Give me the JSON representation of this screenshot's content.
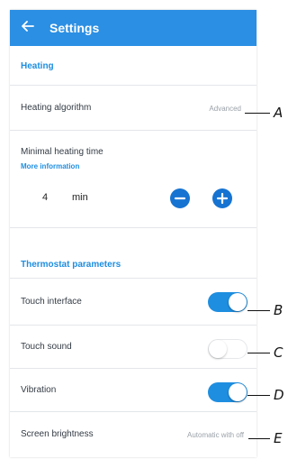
{
  "header": {
    "title": "Settings",
    "back_icon": "arrow-left-icon",
    "background": "#2b8fe3"
  },
  "sections": {
    "heating_title": "Heating",
    "thermostat_title": "Thermostat parameters"
  },
  "heating": {
    "algorithm_label": "Heating algorithm",
    "algorithm_value": "Advanced",
    "min_time_label": "Minimal heating time",
    "more_info": "More information",
    "min_time_value": "4",
    "min_time_unit": "min",
    "decrease_icon": "minus-icon",
    "increase_icon": "plus-icon"
  },
  "thermostat": {
    "touch_interface_label": "Touch interface",
    "touch_interface_on": true,
    "touch_sound_label": "Touch sound",
    "touch_sound_on": false,
    "vibration_label": "Vibration",
    "vibration_on": true,
    "brightness_label": "Screen brightness",
    "brightness_value": "Automatic with off"
  },
  "callouts": [
    "A",
    "B",
    "C",
    "D",
    "E"
  ],
  "colors": {
    "accent": "#1e8ee0",
    "button": "#1673d1"
  }
}
